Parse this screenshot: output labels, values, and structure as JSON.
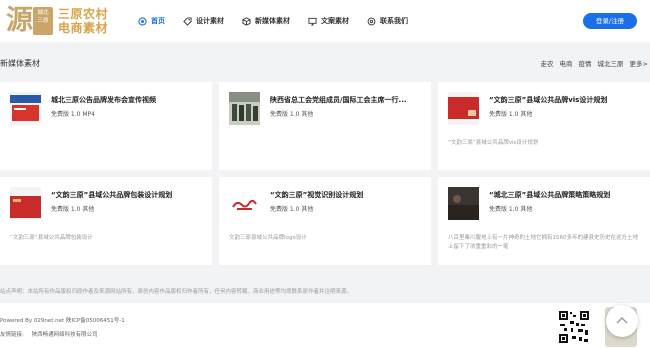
{
  "brand": {
    "mark": "源",
    "seal_lines": [
      "城北",
      "三原"
    ],
    "name_line1": "三原农村",
    "name_line2": "电商素材"
  },
  "nav": [
    {
      "label": "首页",
      "icon": "target-icon",
      "active": true
    },
    {
      "label": "设计素材",
      "icon": "tag-icon",
      "active": false
    },
    {
      "label": "新媒体素材",
      "icon": "cube-icon",
      "active": false
    },
    {
      "label": "文案素材",
      "icon": "monitor-icon",
      "active": false
    },
    {
      "label": "联系我们",
      "icon": "settings-icon",
      "active": false
    }
  ],
  "login_label": "登录/注册",
  "section": {
    "title": "新媒体素材",
    "tags": [
      "走农",
      "电商",
      "疫情",
      "城北三原",
      "更多>"
    ]
  },
  "cards": [
    {
      "title": "城北三原公告品牌发布会宣传视频",
      "meta": "免费版 1.0 MP4",
      "desc": "",
      "thumb": "red-doc"
    },
    {
      "title": "陕西省总工会党组成员/国际工会主席一行...",
      "meta": "免费版 1.0 其他",
      "desc": "",
      "thumb": "photo-people"
    },
    {
      "title": "“文韵三原”县域公共品牌vis设计规划",
      "meta": "免费版 1.0 其他",
      "desc": "“文韵三原”县域公共品牌vis设计规划",
      "thumb": "red-cover"
    },
    {
      "title": "“文韵三原”县域公共品牌包装设计规划",
      "meta": "免费版 1.0 其他",
      "desc": "“文韵三原”县域公共品牌包装设计",
      "thumb": "red-box"
    },
    {
      "title": "“文韵三原”视觉识别设计规划",
      "meta": "免费版 1.0 其他",
      "desc": "文韵三原县域公共品牌logo设计",
      "thumb": "logo-mark"
    },
    {
      "title": "“城北三原”县域公共品牌策略策略规划",
      "meta": "免费版 1.0 其他",
      "desc": "八百里秦川腹地上有一片神奇的土地它拥有1560多年的建县史历史在这方土地上留下了浓重重彩的一笔",
      "thumb": "dark-photo"
    }
  ],
  "disclaimer": "站点声明：本站所有作品版权归原作者及来源网站所有，原创内容作品版权归作者所有，任何内容转载、商业用途等均须联系原作者并注明来源。",
  "footer": {
    "powered": "Powered By 029net.net 陕ICP备05006451号-1",
    "links_label": "友情链接:",
    "link1": "陕西畅通网络科技有限公司"
  },
  "colors": {
    "accent": "#1a6fe8",
    "brand_gold": "#d9a24b"
  }
}
